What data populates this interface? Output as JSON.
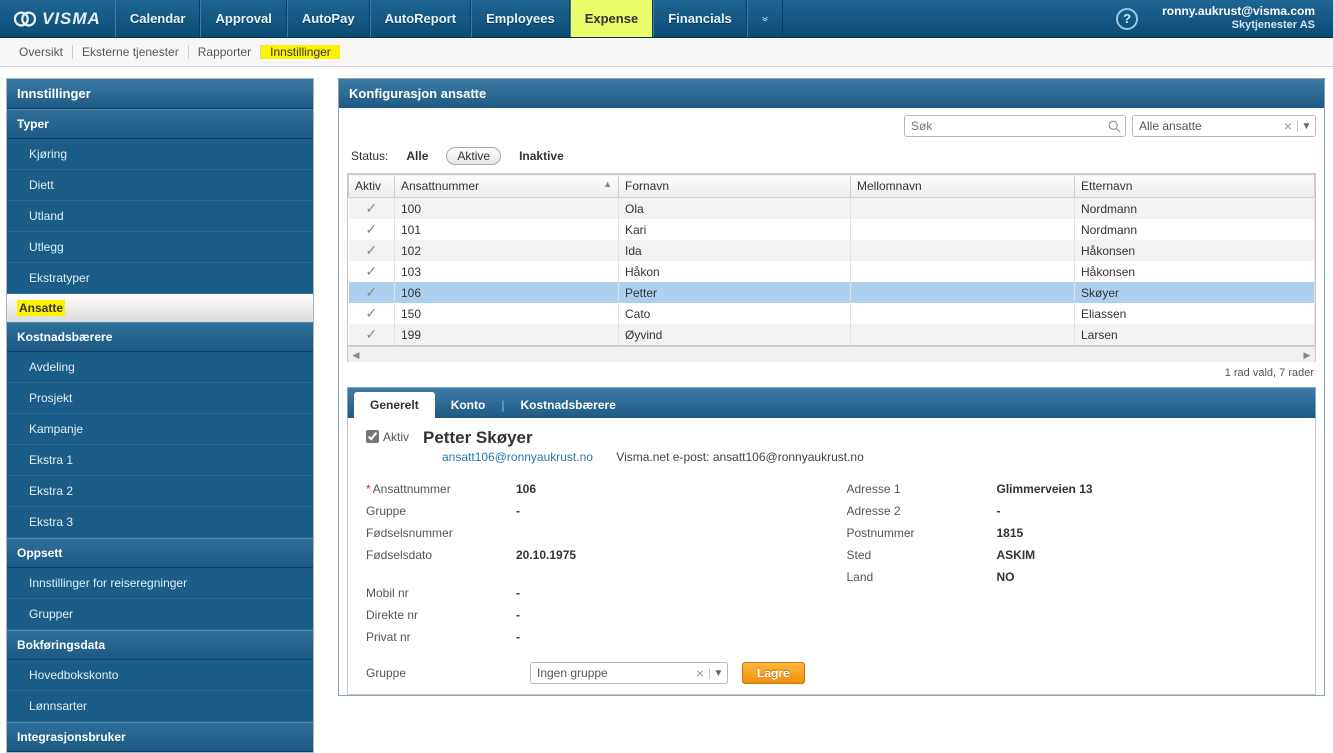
{
  "brand": "VISMA",
  "topmenu": [
    "Calendar",
    "Approval",
    "AutoPay",
    "AutoReport",
    "Employees",
    "Expense",
    "Financials"
  ],
  "topmenu_active": 5,
  "user": {
    "email": "ronny.aukrust@visma.com",
    "company": "Skytjenester AS"
  },
  "submenu": [
    "Oversikt",
    "Eksterne tjenester",
    "Rapporter",
    "Innstillinger"
  ],
  "submenu_active": 3,
  "sidebar": {
    "title": "Innstillinger",
    "groups": [
      {
        "title": "Typer",
        "items": [
          "Kjøring",
          "Diett",
          "Utland",
          "Utlegg",
          "Ekstratyper"
        ]
      },
      {
        "active": "Ansatte"
      },
      {
        "title": "Kostnadsbærere",
        "items": [
          "Avdeling",
          "Prosjekt",
          "Kampanje",
          "Ekstra 1",
          "Ekstra 2",
          "Ekstra 3"
        ]
      },
      {
        "title": "Oppsett",
        "items": [
          "Innstillinger for reiseregninger",
          "Grupper"
        ]
      },
      {
        "title": "Bokføringsdata",
        "items": [
          "Hovedbokskonto",
          "Lønnsarter"
        ]
      },
      {
        "title": "Integrasjonsbruker"
      }
    ]
  },
  "panel": {
    "title": "Konfigurasjon ansatte",
    "search_placeholder": "Søk",
    "filter_value": "Alle ansatte",
    "status": {
      "label": "Status:",
      "options": [
        "Alle",
        "Aktive",
        "Inaktive"
      ],
      "active": 1
    },
    "columns": [
      "Aktiv",
      "Ansattnummer",
      "Fornavn",
      "Mellomnavn",
      "Etternavn"
    ],
    "rows": [
      {
        "aktiv": true,
        "nr": "100",
        "fn": "Ola",
        "mn": "",
        "en": "Nordmann"
      },
      {
        "aktiv": true,
        "nr": "101",
        "fn": "Kari",
        "mn": "",
        "en": "Nordmann"
      },
      {
        "aktiv": true,
        "nr": "102",
        "fn": "Ida",
        "mn": "",
        "en": "Håkonsen"
      },
      {
        "aktiv": true,
        "nr": "103",
        "fn": "Håkon",
        "mn": "",
        "en": "Håkonsen"
      },
      {
        "aktiv": true,
        "nr": "106",
        "fn": "Petter",
        "mn": "",
        "en": "Skøyer",
        "sel": true
      },
      {
        "aktiv": true,
        "nr": "150",
        "fn": "Cato",
        "mn": "",
        "en": "Eliassen"
      },
      {
        "aktiv": true,
        "nr": "199",
        "fn": "Øyvind",
        "mn": "",
        "en": "Larsen"
      }
    ],
    "footer": "1 rad vald, 7 rader",
    "tabs": [
      "Generelt",
      "Konto",
      "Kostnadsbærere"
    ],
    "aktiv_label": "Aktiv",
    "person_name": "Petter Skøyer",
    "email": "ansatt106@ronnyaukrust.no",
    "visma_email_label": "Visma.net e-post:",
    "visma_email": "ansatt106@ronnyaukrust.no",
    "left_fields": [
      {
        "label": "Ansattnummer",
        "value": "106",
        "req": true
      },
      {
        "label": "Gruppe",
        "value": "-"
      },
      {
        "label": "Fødselsnummer",
        "value": ""
      },
      {
        "label": "Fødselsdato",
        "value": "20.10.1975"
      }
    ],
    "left_fields2": [
      {
        "label": "Mobil nr",
        "value": "-"
      },
      {
        "label": "Direkte nr",
        "value": "-"
      },
      {
        "label": "Privat nr",
        "value": "-"
      }
    ],
    "right_fields": [
      {
        "label": "Adresse 1",
        "value": "Glimmerveien 13"
      },
      {
        "label": "Adresse 2",
        "value": "-"
      },
      {
        "label": "Postnummer",
        "value": "1815"
      },
      {
        "label": "Sted",
        "value": "ASKIM"
      },
      {
        "label": "Land",
        "value": "NO"
      }
    ],
    "group_label": "Gruppe",
    "group_value": "Ingen gruppe",
    "save": "Lagre"
  }
}
